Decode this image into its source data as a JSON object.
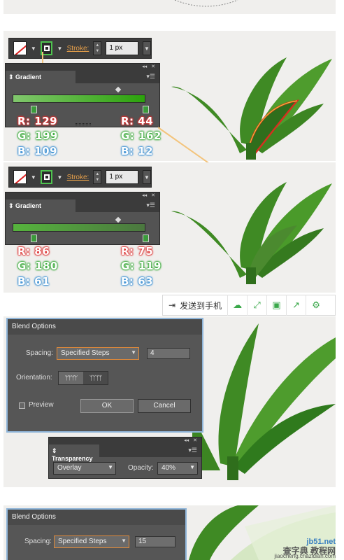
{
  "section1": {
    "stroke_label": "Stroke:",
    "stroke_value": "1 px",
    "gradient_title": "Gradient",
    "left": {
      "r": "R: 129",
      "g": "G: 199",
      "b": "B: 109"
    },
    "right": {
      "r": "R: 44",
      "g": "G: 162",
      "b": "B: 12"
    },
    "colors": {
      "start": "#81c76d",
      "end": "#2ca20c"
    }
  },
  "section2": {
    "stroke_label": "Stroke:",
    "stroke_value": "1 px",
    "gradient_title": "Gradient",
    "left": {
      "r": "R: 86",
      "g": "G: 180",
      "b": "B: 61"
    },
    "right": {
      "r": "R: 75",
      "g": "G: 119",
      "b": "B: 63"
    },
    "colors": {
      "start": "#56b43d",
      "end": "#4b773f"
    }
  },
  "share_bar": {
    "send_label": "发送到手机",
    "icons": [
      "phone-send-icon",
      "cloud-icon",
      "expand-icon",
      "save-icon",
      "share-icon",
      "settings-gear-icon"
    ]
  },
  "blend1": {
    "title": "Blend Options",
    "spacing_label": "Spacing:",
    "spacing_value": "Specified Steps",
    "steps_value": "4",
    "orientation_label": "Orientation:",
    "preview_label": "Preview",
    "ok_label": "OK",
    "cancel_label": "Cancel"
  },
  "transparency": {
    "title": "Transparency",
    "mode_value": "Overlay",
    "opacity_label": "Opacity:",
    "opacity_value": "40%"
  },
  "blend2": {
    "title": "Blend Options",
    "spacing_label": "Spacing:",
    "spacing_value": "Specified Steps",
    "steps_value": "15"
  },
  "watermark": {
    "line1": "查字典 教程网",
    "line2": "jiaocheng.chazidian.com",
    "line3": "jb51.net"
  },
  "accent": {
    "callout_line": "#f3c37a",
    "leaf_dark": "#2f6e1c",
    "leaf_light": "#6cb23e"
  }
}
